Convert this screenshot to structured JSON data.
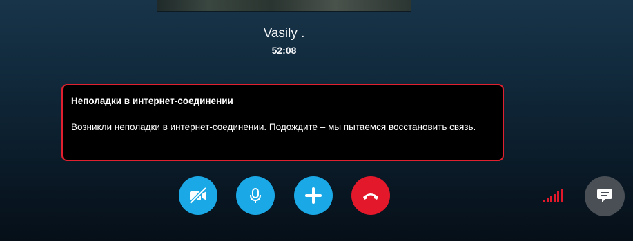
{
  "call": {
    "caller_name": "Vasily .",
    "timer": "52:08"
  },
  "notice": {
    "title": "Неполадки в интернет-соединении",
    "message": "Возникли неполадки в интернет-соединении. Подождите – мы пытаемся восстановить связь."
  },
  "controls": {
    "video_icon": "video-off-icon",
    "mic_icon": "microphone-icon",
    "add_icon": "plus-icon",
    "end_icon": "hang-up-icon",
    "chat_icon": "chat-bubble-icon",
    "signal_icon": "signal-strength-icon",
    "signal_level": 0.2
  },
  "colors": {
    "accent_blue": "#1aa9e6",
    "end_call_red": "#e3182b",
    "notice_border": "#e0202e",
    "signal_red": "#e3182b"
  }
}
